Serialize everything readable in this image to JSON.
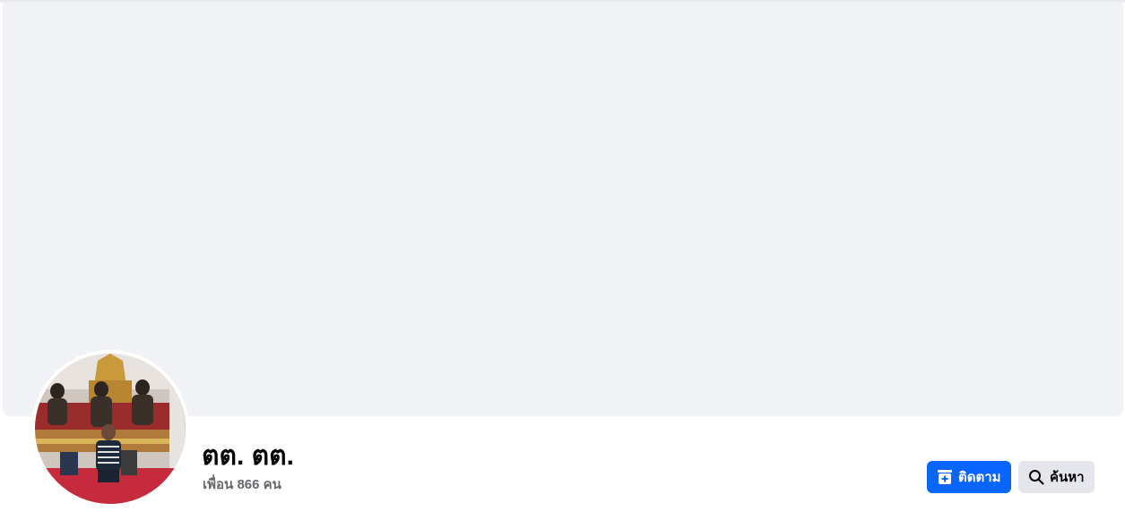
{
  "profile": {
    "name": "ตต. ตต.",
    "friends_text": "เพื่อน 866 คน"
  },
  "actions": {
    "follow_label": "ติดตาม",
    "follow_icon": "follow-icon",
    "search_label": "ค้นหา",
    "search_icon": "search-icon"
  },
  "colors": {
    "primary_button": "#0866ff",
    "secondary_button": "#e4e6eb",
    "cover_bg": "#f0f2f5",
    "secondary_text": "#65676b"
  }
}
